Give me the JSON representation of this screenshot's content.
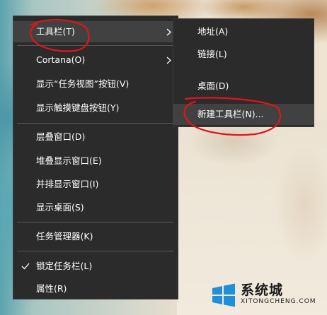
{
  "main_menu": {
    "items": [
      {
        "label": "工具栏(T)",
        "has_submenu": true
      },
      {
        "label": "Cortana(O)",
        "has_submenu": true
      },
      {
        "label": "显示“任务视图”按钮(V)"
      },
      {
        "label": "显示触摸键盘按钮(Y)"
      },
      {
        "label": "层叠窗口(D)"
      },
      {
        "label": "堆叠显示窗口(E)"
      },
      {
        "label": "并排显示窗口(I)"
      },
      {
        "label": "显示桌面(S)"
      },
      {
        "label": "任务管理器(K)"
      },
      {
        "label": "锁定任务栏(L)",
        "checked": true
      },
      {
        "label": "属性(R)"
      }
    ]
  },
  "toolbar_submenu": {
    "items": [
      {
        "label": "地址(A)"
      },
      {
        "label": "链接(L)"
      },
      {
        "label": "桌面(D)"
      },
      {
        "label": "新建工具栏(N)..."
      }
    ]
  },
  "watermark": {
    "cn": "系统城",
    "en": "XITONGCHENG.COM"
  },
  "colors": {
    "menu_bg": "#2b2b2b",
    "menu_highlight": "#414141",
    "annotation": "#e0151b"
  }
}
